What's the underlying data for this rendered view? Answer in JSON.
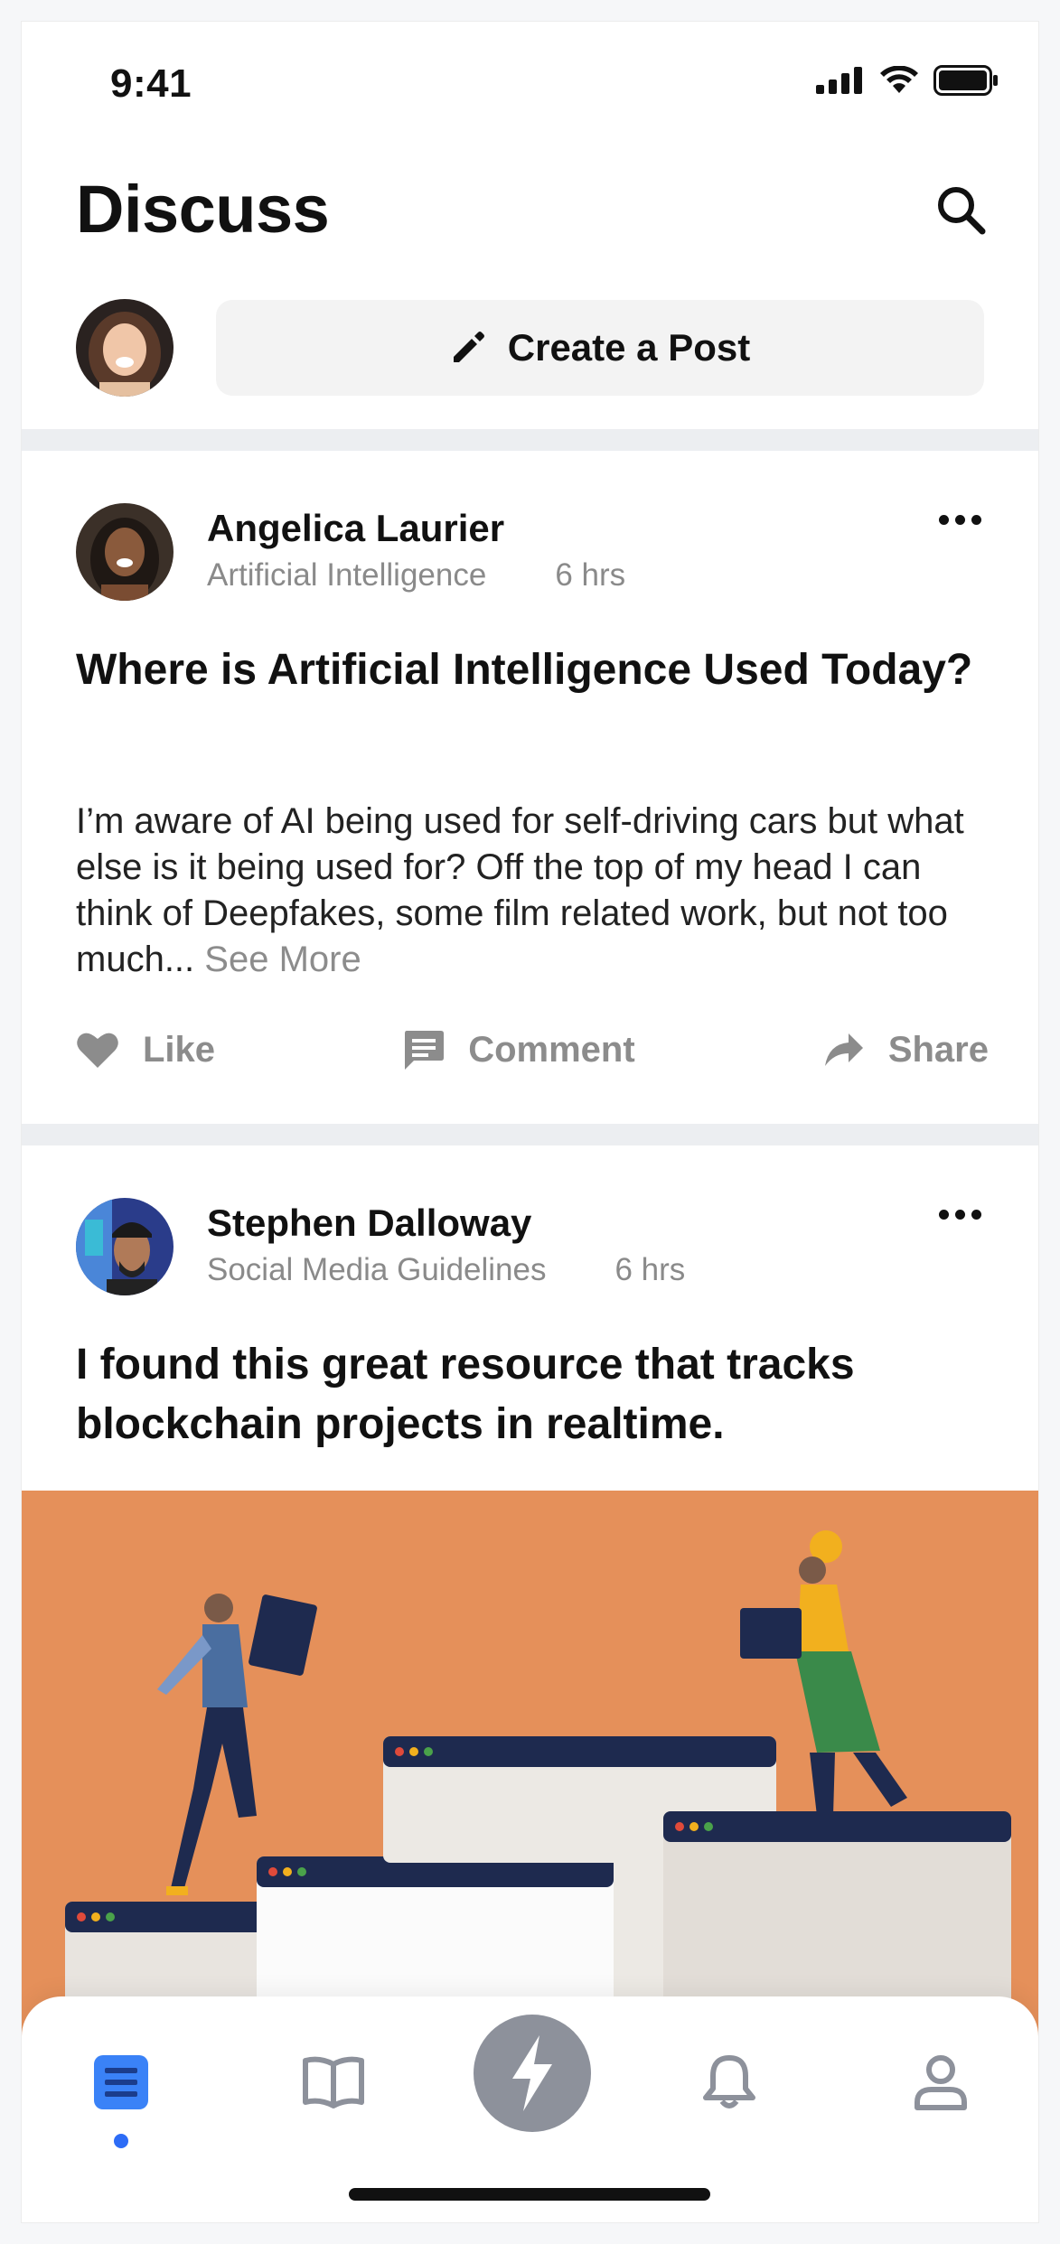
{
  "status_bar": {
    "time": "9:41"
  },
  "header": {
    "title": "Discuss"
  },
  "composer": {
    "create_label": "Create a Post"
  },
  "posts": [
    {
      "author": "Angelica Laurier",
      "category": "Artificial Intelligence",
      "time": "6 hrs",
      "title": "Where is Artificial Intelligence Used Today?",
      "body": "I’m aware of AI being used for self-driving cars but what else is it being used for? Off the top of my head I can think of Deepfakes, some film related work, but not too much...",
      "see_more": "See More",
      "actions": {
        "like": "Like",
        "comment": "Comment",
        "share": "Share"
      }
    },
    {
      "author": "Stephen Dalloway",
      "category": "Social Media Guidelines",
      "time": "6 hrs",
      "title": "I found this great resource that tracks blockchain projects in realtime."
    }
  ],
  "bottom_nav": {
    "items": [
      "feed-icon",
      "book-icon",
      "lightning-icon",
      "bell-icon",
      "profile-icon"
    ],
    "active": "feed-icon"
  },
  "colors": {
    "accent": "#2d6cf6",
    "illustration_bg": "#e5905a",
    "muted_text": "#8c8c8c",
    "fab": "#8d919b"
  }
}
